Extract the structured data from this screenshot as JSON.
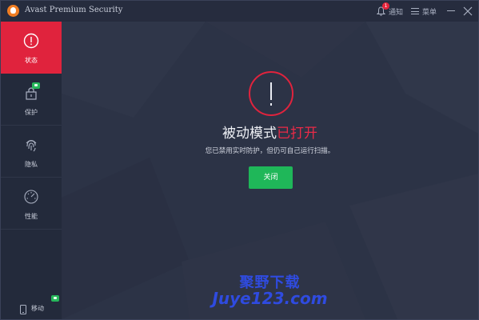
{
  "app": {
    "title": "Avast Premium Security",
    "notify_label": "通知",
    "notify_badge": "1",
    "menu_label": "菜单"
  },
  "sidebar": {
    "items": [
      {
        "label": "状态",
        "icon": "exclamation-circle-icon",
        "active": true
      },
      {
        "label": "保护",
        "icon": "lock-icon",
        "active": false
      },
      {
        "label": "隐私",
        "icon": "fingerprint-icon",
        "active": false
      },
      {
        "label": "性能",
        "icon": "speedometer-icon",
        "active": false
      }
    ],
    "mobile_label": "移动"
  },
  "main": {
    "headline_prefix": "被动模式",
    "headline_highlight": "已打开",
    "subtext": "您已禁用实时防护，但仍可自己运行扫描。",
    "off_button": "关闭"
  },
  "watermark": {
    "line1": "聚野下载",
    "line2": "Juye123.com"
  },
  "colors": {
    "accent_red": "#e0233d",
    "button_green": "#1fb759",
    "sidebar_bg": "#232a3b",
    "main_bg": "#2c3346"
  }
}
